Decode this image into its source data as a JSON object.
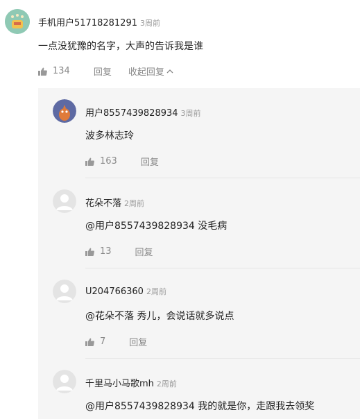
{
  "top_comment": {
    "username": "手机用户51718281291",
    "time": "3周前",
    "text": "一点没犹豫的名字，大声的告诉我是谁",
    "likes": "134",
    "reply_label": "回复",
    "collapse_label": "收起回复"
  },
  "replies": [
    {
      "username": "用户8557439828934",
      "time": "3周前",
      "text": "波多林志玲",
      "likes": "163",
      "reply_label": "回复"
    },
    {
      "username": "花朵不落",
      "time": "2周前",
      "text": "@用户8557439828934 没毛病",
      "likes": "13",
      "reply_label": "回复"
    },
    {
      "username": "U204766360",
      "time": "2周前",
      "text": "@花朵不落 秀儿，会说话就多说点",
      "likes": "7",
      "reply_label": "回复"
    },
    {
      "username": "千里马小马歌mh",
      "time": "2周前",
      "text": "@用户8557439828934 我的就是你，走跟我去领奖"
    }
  ],
  "colors": {
    "panel_bg": "#f5f5f5",
    "text_muted": "#999999",
    "action_gray": "#888888"
  }
}
